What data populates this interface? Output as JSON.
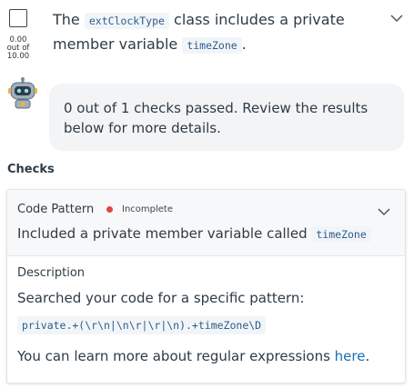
{
  "question": {
    "text_before": "The ",
    "class_code": "extClockType",
    "text_middle": " class includes a private member variable ",
    "member_code": "timeZone",
    "text_after": "."
  },
  "score": {
    "points": "0.00",
    "out_of_label": "out of",
    "total": "10.00"
  },
  "feedback": {
    "message": "0 out of 1 checks passed. Review the results below for more details."
  },
  "checks": {
    "heading": "Checks",
    "items": [
      {
        "title": "Code Pattern",
        "status": "Incomplete",
        "status_color": "#e0474c",
        "summary_text": "Included a private member variable called ",
        "summary_code": "timeZone",
        "description_heading": "Description",
        "description_text": "Searched your code for a specific pattern:",
        "pattern": "private.+(\\r\\n|\\n\\r|\\r|\\n).+timeZone\\D",
        "learn_more_text": "You can learn more about regular expressions ",
        "learn_more_link": "here",
        "learn_more_after": "."
      }
    ]
  },
  "icons": {
    "question_toggle": "chevron-down-icon",
    "check_toggle": "chevron-down-icon",
    "assistant": "robot-avatar-icon",
    "status": "status-dot-icon"
  }
}
